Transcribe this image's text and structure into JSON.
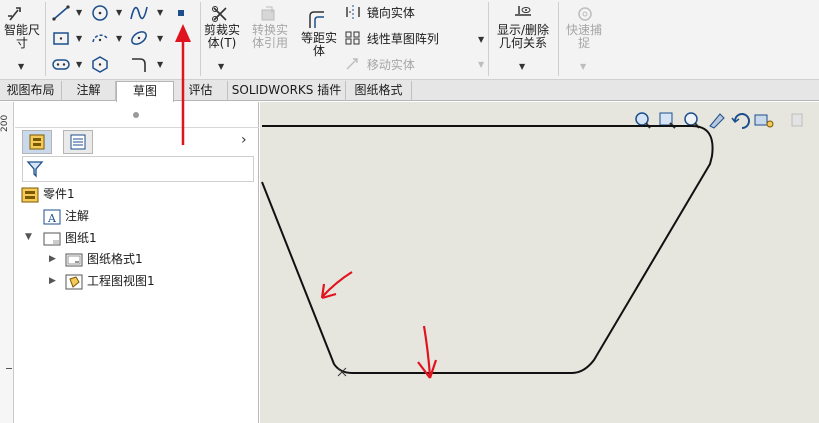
{
  "ribbon": {
    "smart_dimension": "智能尺寸",
    "smart_dimension_line1": "智能尺",
    "smart_dimension_line2": "寸",
    "trim_entities_line1": "剪裁实",
    "trim_entities_line2": "体(T)",
    "convert_entities_line1": "转换实",
    "convert_entities_line2": "体引用",
    "offset_entities_line1": "等距实",
    "offset_entities_line2": "体",
    "mirror_entities": "镜向实体",
    "linear_pattern": "线性草图阵列",
    "move_entities": "移动实体",
    "display_relations_line1": "显示/删除",
    "display_relations_line2": "几何关系",
    "quick_snaps_line1": "快速捕",
    "quick_snaps_line2": "捉"
  },
  "tabs": [
    {
      "label": "视图布局",
      "active": false
    },
    {
      "label": "注解",
      "active": false
    },
    {
      "label": "草图",
      "active": true
    },
    {
      "label": "评估",
      "active": false
    },
    {
      "label": "SOLIDWORKS 插件",
      "active": false
    },
    {
      "label": "图纸格式",
      "active": false
    }
  ],
  "ruler": {
    "label": "200"
  },
  "tree": {
    "root": "零件1",
    "annotations": "注解",
    "sheet": "图纸1",
    "sheet_format": "图纸格式1",
    "drawing_view": "工程图视图1"
  },
  "colors": {
    "ribbon_bg": "#f3f3f3",
    "canvas_bg": "#e6e6df",
    "annotation_red": "#e0141e",
    "active_tab": "#ffffff",
    "disabled_text": "#a6a6a6"
  },
  "icons": {
    "smart_dimension": "smart-dimension-icon",
    "line": "line-icon",
    "rectangle": "rectangle-icon",
    "slot": "slot-icon",
    "circle": "circle-icon",
    "arc": "arc-icon",
    "polygon": "polygon-icon",
    "spline": "spline-icon",
    "ellipse": "ellipse-icon",
    "fillet": "fillet-icon",
    "point": "point-icon",
    "trim": "trim-icon",
    "convert": "convert-entities-icon",
    "offset": "offset-entities-icon",
    "mirror": "mirror-icon",
    "pattern": "linear-pattern-icon",
    "move": "move-icon",
    "relations": "display-relations-icon",
    "snaps": "quick-snaps-icon"
  }
}
